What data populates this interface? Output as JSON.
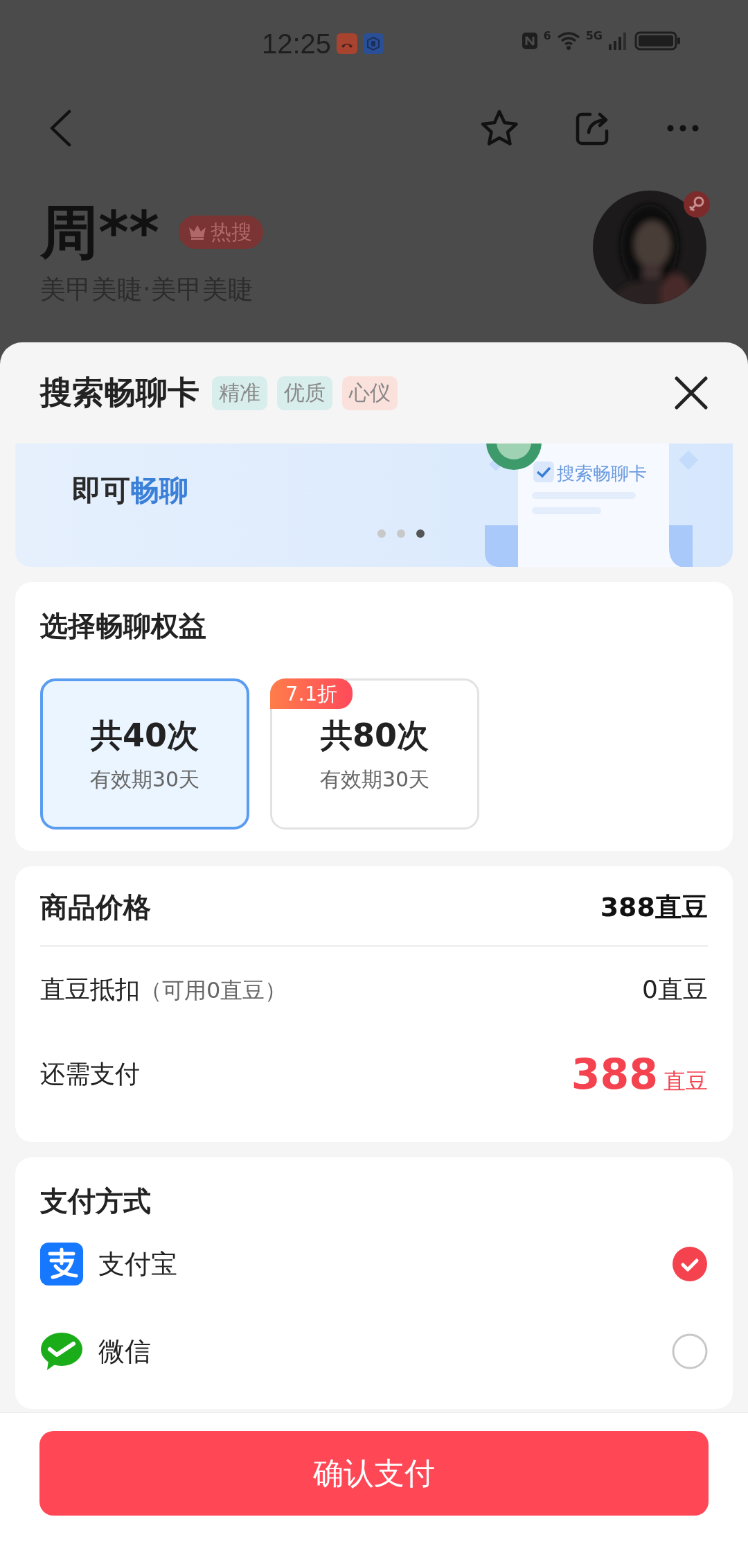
{
  "status_bar": {
    "time": "12:25",
    "wifi_label": "6",
    "network": "5G"
  },
  "profile": {
    "name": "周**",
    "badge": "热搜",
    "subtitle": "美甲美睫·美甲美睫"
  },
  "sheet": {
    "title": "搜索畅聊卡",
    "tags": [
      {
        "label": "精准",
        "color": "#d8eeec"
      },
      {
        "label": "优质",
        "color": "#d8eeec"
      },
      {
        "label": "心仪",
        "color": "#fbe1dc"
      }
    ]
  },
  "banner": {
    "headline_prefix": "即可",
    "headline_highlight": "畅聊",
    "card_label": "搜索畅聊卡",
    "dots": [
      {
        "selected": false
      },
      {
        "selected": false
      },
      {
        "selected": true
      }
    ]
  },
  "benefits": {
    "title": "选择畅聊权益",
    "options": [
      {
        "count": "共40次",
        "validity": "有效期30天",
        "selected": true
      },
      {
        "count": "共80次",
        "validity": "有效期30天",
        "badge": "7.1折",
        "selected": false
      }
    ]
  },
  "price": {
    "title": "商品价格",
    "value": "388直豆",
    "deduction_label": "直豆抵扣",
    "deduction_note": "（可用0直豆）",
    "deduction_value": "0直豆",
    "due_label": "还需支付",
    "due_amount": "388",
    "due_unit": "直豆"
  },
  "payment": {
    "title": "支付方式",
    "methods": [
      {
        "kind": "alipay",
        "name": "支付宝",
        "selected": true
      },
      {
        "kind": "wechat",
        "name": "微信",
        "selected": false
      }
    ]
  },
  "confirm_button": "确认支付"
}
